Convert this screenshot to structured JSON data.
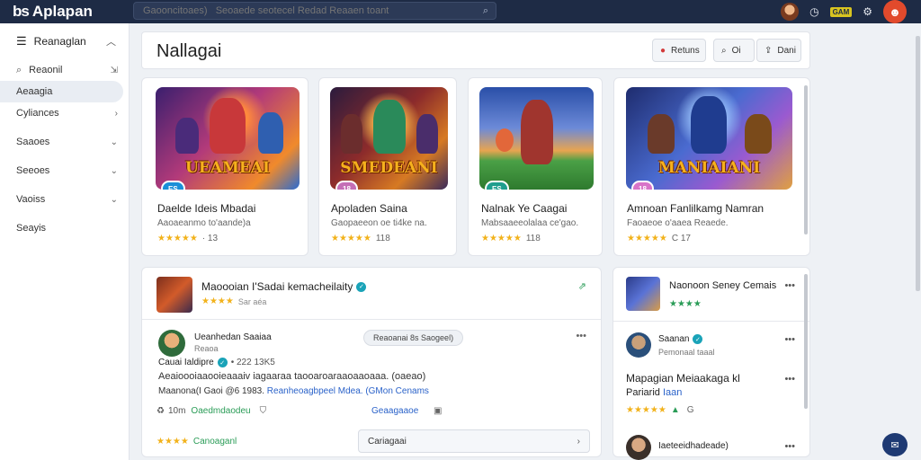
{
  "app": {
    "logo_mark": "bs",
    "logo_text": "Aplapan",
    "search_placeholder": "Gaooncitoaes)   Seoaede seotecel Redad Reaaen toant"
  },
  "topbar": {
    "badge": "GAM",
    "icon_help": "◷",
    "icon_settings": "⚙",
    "profile_icon": "☻"
  },
  "sidebar": {
    "header": "Reanaglan",
    "items": [
      {
        "label": "Reaonil",
        "icon": "⌕"
      },
      {
        "label": "Aeaagia"
      },
      {
        "label": "Cyliances"
      },
      {
        "label": "Saaoes"
      },
      {
        "label": "Seeoes"
      },
      {
        "label": "Vaoiss"
      },
      {
        "label": "Seayis"
      }
    ]
  },
  "page": {
    "title": "Nallagai",
    "btn_return": "Retuns",
    "btn_search": "Oi",
    "btn_share": "Dani"
  },
  "games": [
    {
      "art_title": "UEAMEAI",
      "pill": "ES",
      "pill_color": "#1a8fd8",
      "title": "Daelde Ideis Mbadai",
      "sub": "Aaoaeanmo to'aande)a",
      "stars": "★★★★★",
      "count": "· 13"
    },
    {
      "art_title": "SMEDEANI",
      "pill": "18",
      "pill_color": "#c46fb6",
      "title": "Apoladen Saina",
      "sub": "Gaopaeeon oe ti4ke na.",
      "stars": "★★★★★",
      "count": "118"
    },
    {
      "art_title": "",
      "pill": "ES",
      "pill_color": "#1f9e8e",
      "title": "Nalnak Ye Caagai",
      "sub": "Mabsaaeeolalaa ce'gao.",
      "stars": "★★★★★",
      "count": "118"
    },
    {
      "art_title": "MANIAIANI",
      "pill": "18",
      "pill_color": "#d874c8",
      "title": "Amnoan Fanlilkamg Namran",
      "sub": "Faoaeoe o'aaea Reaede.",
      "stars": "★★★★★",
      "count": "C 17"
    }
  ],
  "feed": {
    "title": "Maoooian I'Sadai kemacheilaity",
    "stars": "★★★★",
    "meta": "Sar aéa",
    "corner": "⇗",
    "post": {
      "name": "Ueanhedan Saaiaa",
      "role": "Reaoa",
      "chip": "Reaoanai 8s Saogeel)",
      "title": "Cauai Ialdipre",
      "meta": "• 222  13K5",
      "body": "Aeaioooiaaooieaaaiv iagaaraa taooaroaraaoaaoaaa. (oaeao)",
      "line3_a": "Maanona(I Gaoi @6 1983.",
      "line3_b": "Reanheoagbpeel Mdea. (GMon Cenams",
      "likes": "10m",
      "action": "Oaedmdaodeu",
      "share": "Geaagaaoe",
      "foot": "Canoaganl",
      "comment": "Cariagaai"
    }
  },
  "right_panel": {
    "title": "Naonoon Seney Cemais",
    "stars": "★★★★",
    "user1_name": "Saanan",
    "user1_sub": "Pemonaal taaal",
    "big_title": "Mapagian Meiaakaga kl",
    "big_sub_a": "Pariarid",
    "big_sub_b": "Iaan",
    "rate_stars": "★★★★★",
    "rate_count": "G",
    "user2_name": "Iaeteeidhadeade)"
  },
  "colors": {
    "topbar_bg": "#1e2b45",
    "accent_blue": "#2a62c9",
    "accent_green": "#2a9c57",
    "star": "#f2b21b",
    "profile": "#e24a2c"
  }
}
